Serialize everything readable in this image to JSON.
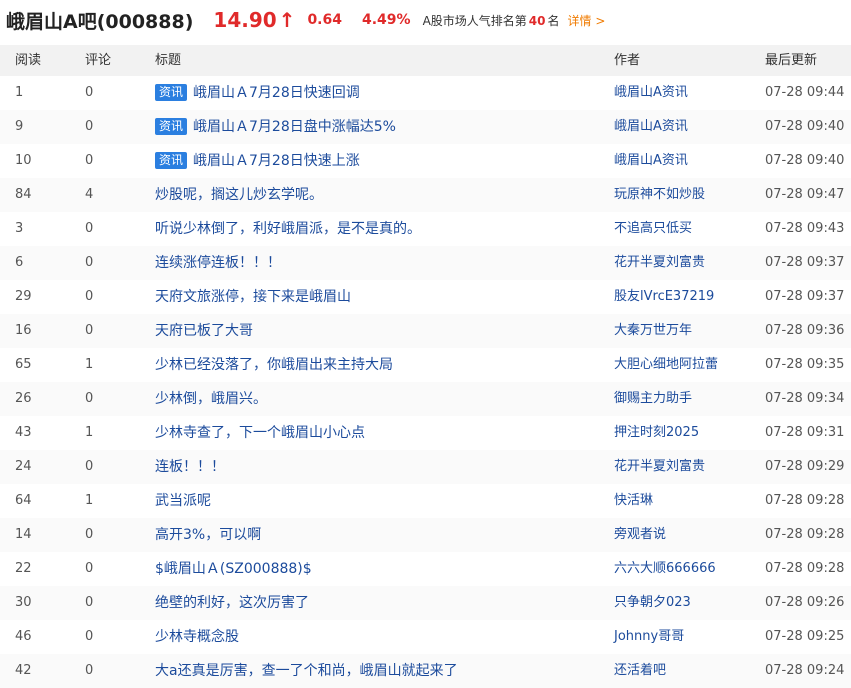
{
  "header": {
    "bar_name": "峨眉山A吧(000888)",
    "price": "14.90",
    "arrow": "↑",
    "change": "0.64",
    "change_pct": "4.49%",
    "rank_prefix": "A股市场人气排名第",
    "rank": "40",
    "rank_suffix": "名",
    "detail_link": "详情",
    "detail_chevron": ">"
  },
  "table": {
    "columns": {
      "read": "阅读",
      "comment": "评论",
      "title": "标题",
      "author": "作者",
      "updated": "最后更新"
    },
    "rows": [
      {
        "read": "1",
        "comment": "0",
        "tag": "资讯",
        "title": "峨眉山Ａ7月28日快速回调",
        "author": "峨眉山A资讯",
        "updated": "07-28 09:44"
      },
      {
        "read": "9",
        "comment": "0",
        "tag": "资讯",
        "title": "峨眉山Ａ7月28日盘中涨幅达5%",
        "author": "峨眉山A资讯",
        "updated": "07-28 09:40"
      },
      {
        "read": "10",
        "comment": "0",
        "tag": "资讯",
        "title": "峨眉山Ａ7月28日快速上涨",
        "author": "峨眉山A资讯",
        "updated": "07-28 09:40"
      },
      {
        "read": "84",
        "comment": "4",
        "tag": "",
        "title": "炒股呢，搁这儿炒玄学呢。",
        "author": "玩原神不如炒股",
        "updated": "07-28 09:47"
      },
      {
        "read": "3",
        "comment": "0",
        "tag": "",
        "title": "听说少林倒了，利好峨眉派，是不是真的。",
        "author": "不追高只低买",
        "updated": "07-28 09:43"
      },
      {
        "read": "6",
        "comment": "0",
        "tag": "",
        "title": "连续涨停连板！！！",
        "author": "花开半夏刘富贵",
        "updated": "07-28 09:37"
      },
      {
        "read": "29",
        "comment": "0",
        "tag": "",
        "title": "天府文旅涨停，接下来是峨眉山",
        "author": "股友lVrcE37219",
        "updated": "07-28 09:37"
      },
      {
        "read": "16",
        "comment": "0",
        "tag": "",
        "title": "天府已板了大哥",
        "author": "大秦万世万年",
        "updated": "07-28 09:36"
      },
      {
        "read": "65",
        "comment": "1",
        "tag": "",
        "title": "少林已经没落了，你峨眉出来主持大局",
        "author": "大胆心细地阿拉蕾",
        "updated": "07-28 09:35"
      },
      {
        "read": "26",
        "comment": "0",
        "tag": "",
        "title": "少林倒，峨眉兴。",
        "author": "御赐主力助手",
        "updated": "07-28 09:34"
      },
      {
        "read": "43",
        "comment": "1",
        "tag": "",
        "title": "少林寺查了，下一个峨眉山小心点",
        "author": "押注时刻2025",
        "updated": "07-28 09:31"
      },
      {
        "read": "24",
        "comment": "0",
        "tag": "",
        "title": "连板！！！",
        "author": "花开半夏刘富贵",
        "updated": "07-28 09:29"
      },
      {
        "read": "64",
        "comment": "1",
        "tag": "",
        "title": "武当派呢",
        "author": "快活琳",
        "updated": "07-28 09:28"
      },
      {
        "read": "14",
        "comment": "0",
        "tag": "",
        "title": "高开3%，可以啊",
        "author": "旁观者说",
        "updated": "07-28 09:28"
      },
      {
        "read": "22",
        "comment": "0",
        "tag": "",
        "title": "$峨眉山Ａ(SZ000888)$",
        "author": "六六大顺666666",
        "updated": "07-28 09:28"
      },
      {
        "read": "30",
        "comment": "0",
        "tag": "",
        "title": "绝壁的利好，这次厉害了",
        "author": "只争朝夕023",
        "updated": "07-28 09:26"
      },
      {
        "read": "46",
        "comment": "0",
        "tag": "",
        "title": "少林寺概念股",
        "author": "Johnny哥哥",
        "updated": "07-28 09:25"
      },
      {
        "read": "42",
        "comment": "0",
        "tag": "",
        "title": "大a还真是厉害，查一了个和尚，峨眉山就起来了",
        "author": "还活着吧",
        "updated": "07-28 09:24"
      }
    ]
  }
}
